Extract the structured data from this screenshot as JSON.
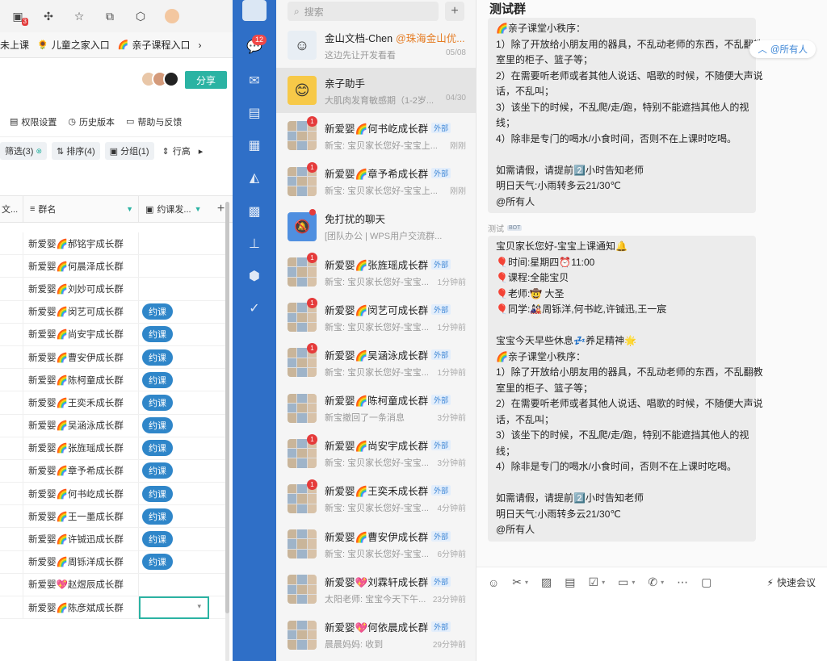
{
  "browser": {
    "bookmarks": [
      {
        "icon": "",
        "label": "未上课"
      },
      {
        "icon": "🌻",
        "label": "儿童之家入口"
      },
      {
        "icon": "🌈",
        "label": "亲子课程入口"
      }
    ],
    "share_label": "分享"
  },
  "sheet": {
    "toolbar": [
      "权限设置",
      "历史版本",
      "帮助与反馈"
    ],
    "view_controls": [
      {
        "label": "筛选(3)",
        "icon": "filter-icon"
      },
      {
        "label": "排序(4)",
        "icon": "sort-icon"
      },
      {
        "label": "分组(1)",
        "icon": "group-icon"
      },
      {
        "label": "行高",
        "icon": "row-height-icon"
      }
    ],
    "columns": [
      "文...",
      "群名",
      "约课发..."
    ],
    "rows": [
      {
        "name": "新爱婴🌈郝铭宇成长群",
        "tag": ""
      },
      {
        "name": "新爱婴🌈何晨泽成长群",
        "tag": ""
      },
      {
        "name": "新爱婴🌈刘妙可成长群",
        "tag": ""
      },
      {
        "name": "新爱婴🌈闵艺可成长群",
        "tag": "约课"
      },
      {
        "name": "新爱婴🌈尚安宇成长群",
        "tag": "约课"
      },
      {
        "name": "新爱婴🌈曹安伊成长群",
        "tag": "约课"
      },
      {
        "name": "新爱婴🌈陈柯童成长群",
        "tag": "约课"
      },
      {
        "name": "新爱婴🌈王奕禾成长群",
        "tag": "约课"
      },
      {
        "name": "新爱婴🌈吴涵泳成长群",
        "tag": "约课"
      },
      {
        "name": "新爱婴🌈张旌瑶成长群",
        "tag": "约课"
      },
      {
        "name": "新爱婴🌈章予希成长群",
        "tag": "约课"
      },
      {
        "name": "新爱婴🌈何书屹成长群",
        "tag": "约课"
      },
      {
        "name": "新爱婴🌈王一墨成长群",
        "tag": "约课"
      },
      {
        "name": "新爱婴🌈许铖迅成长群",
        "tag": "约课"
      },
      {
        "name": "新爱婴🌈周铄洋成长群",
        "tag": "约课"
      },
      {
        "name": "新爱婴💖赵煜辰成长群",
        "tag": ""
      },
      {
        "name": "新爱婴🌈陈彦斌成长群",
        "tag": "selected"
      }
    ]
  },
  "sidebar": {
    "badge": "12"
  },
  "chatlist": {
    "search_placeholder": "搜索",
    "items": [
      {
        "name": "金山文档-Chen",
        "org": "@珠海金山优...",
        "preview": "这边先让开发看看",
        "time": "05/08",
        "badge": "",
        "ext": false
      },
      {
        "name": "亲子助手",
        "org": "",
        "preview": "大肌肉发育敏感期（1-2岁...",
        "time": "04/30",
        "badge": "",
        "ext": false
      },
      {
        "name": "新爱婴🌈何书屹成长群",
        "org": "",
        "preview": "新宝: 宝贝家长您好-宝宝上...",
        "time": "刚刚",
        "badge": "1",
        "ext": true
      },
      {
        "name": "新爱婴🌈章予希成长群",
        "org": "",
        "preview": "新宝: 宝贝家长您好-宝宝上...",
        "time": "刚刚",
        "badge": "1",
        "ext": true
      },
      {
        "name": "免打扰的聊天",
        "org": "",
        "preview": "[团队办公 | WPS用户交流群...",
        "time": "",
        "badge": "dot",
        "ext": false
      },
      {
        "name": "新爱婴🌈张旌瑶成长群",
        "org": "",
        "preview": "新宝: 宝贝家长您好-宝宝...",
        "time": "1分钟前",
        "badge": "1",
        "ext": true
      },
      {
        "name": "新爱婴🌈闵艺可成长群",
        "org": "",
        "preview": "新宝: 宝贝家长您好-宝宝...",
        "time": "1分钟前",
        "badge": "1",
        "ext": true
      },
      {
        "name": "新爱婴🌈吴涵泳成长群",
        "org": "",
        "preview": "新宝: 宝贝家长您好-宝宝...",
        "time": "1分钟前",
        "badge": "1",
        "ext": true
      },
      {
        "name": "新爱婴🌈陈柯童成长群",
        "org": "",
        "preview": "新宝撤回了一条消息",
        "time": "3分钟前",
        "badge": "",
        "ext": true
      },
      {
        "name": "新爱婴🌈尚安宇成长群",
        "org": "",
        "preview": "新宝: 宝贝家长您好-宝宝...",
        "time": "3分钟前",
        "badge": "1",
        "ext": true
      },
      {
        "name": "新爱婴🌈王奕禾成长群",
        "org": "",
        "preview": "新宝: 宝贝家长您好-宝宝...",
        "time": "4分钟前",
        "badge": "1",
        "ext": true
      },
      {
        "name": "新爱婴🌈曹安伊成长群",
        "org": "",
        "preview": "新宝: 宝贝家长您好-宝宝...",
        "time": "6分钟前",
        "badge": "",
        "ext": true
      },
      {
        "name": "新爱婴💖刘霖轩成长群",
        "org": "",
        "preview": "太阳老师: 宝宝今天下午...",
        "time": "23分钟前",
        "badge": "",
        "ext": true
      },
      {
        "name": "新爱婴💖何依晨成长群",
        "org": "",
        "preview": "晨晨妈妈: 收到",
        "time": "29分钟前",
        "badge": "",
        "ext": true
      }
    ]
  },
  "chat": {
    "title": "测试群",
    "at_all_label": "@所有人",
    "sender": "测试",
    "sender_tag": "BOT",
    "bubble1": [
      "🌈亲子课堂小秩序：",
      "1）除了开放给小朋友用的器具，不乱动老师的东西，不乱翻教",
      "室里的柜子、篮子等；",
      "2）在需要听老师或者其他人说话、唱歌的时候，不随便大声说",
      "话，不乱叫；",
      "3）该坐下的时候，不乱爬/走/跑，特别不能遮挡其他人的视",
      "线；",
      "4）除非是专门的喝水/小食时间，否则不在上课时吃喝。",
      "",
      "如需请假，请提前2️⃣小时告知老师",
      "明日天气:小雨转多云21/30℃",
      "@所有人"
    ],
    "bubble2": [
      "宝贝家长您好-宝宝上课通知🔔",
      "🎈时间:星期四⏰11:00",
      "🎈课程:全能宝贝",
      "🎈老师:🤠 大圣",
      "🎈同学:🎎周铄洋,何书屹,许铖迅,王一宸",
      "",
      "宝宝今天早些休息💤养足精神🌟",
      "🌈亲子课堂小秩序：",
      "1）除了开放给小朋友用的器具，不乱动老师的东西，不乱翻教",
      "室里的柜子、篮子等；",
      "2）在需要听老师或者其他人说话、唱歌的时候，不随便大声说",
      "话，不乱叫；",
      "3）该坐下的时候，不乱爬/走/跑，特别不能遮挡其他人的视",
      "线；",
      "4）除非是专门的喝水/小食时间，否则不在上课时吃喝。",
      "",
      "如需请假，请提前2️⃣小时告知老师",
      "明日天气:小雨转多云21/30℃",
      "@所有人"
    ],
    "quick_meeting": "快速会议"
  },
  "colors": {
    "accent": "#2bb3a3",
    "sidebar": "#2f6fc7",
    "tag": "#2f86c9"
  }
}
